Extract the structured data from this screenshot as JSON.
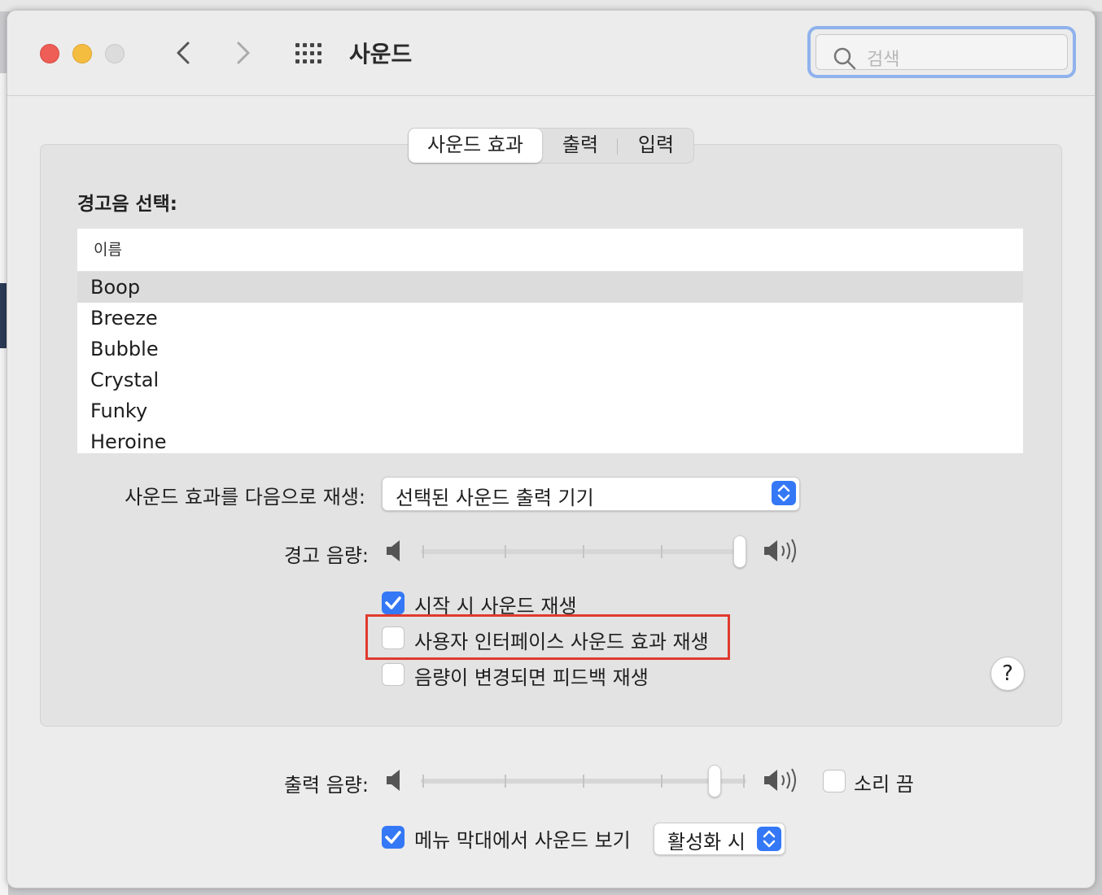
{
  "window": {
    "title": "사운드",
    "search_placeholder": "검색"
  },
  "tabs": [
    {
      "label": "사운드 효과",
      "active": true
    },
    {
      "label": "출력",
      "active": false
    },
    {
      "label": "입력",
      "active": false
    }
  ],
  "alert_section": {
    "label": "경고음 선택:",
    "column_header": "이름",
    "sounds": [
      "Boop",
      "Breeze",
      "Bubble",
      "Crystal",
      "Funky",
      "Heroine"
    ],
    "selected": "Boop"
  },
  "play_through": {
    "label": "사운드 효과를 다음으로 재생:",
    "value": "선택된 사운드 출력 기기"
  },
  "alert_volume": {
    "label": "경고 음량:",
    "level": 1.0
  },
  "checkboxes": [
    {
      "label": "시작 시 사운드 재생",
      "checked": true
    },
    {
      "label": "사용자 인터페이스 사운드 효과 재생",
      "checked": false
    },
    {
      "label": "음량이 변경되면 피드백 재생",
      "checked": false
    }
  ],
  "help_label": "?",
  "output_volume": {
    "label": "출력 음량:",
    "level": 0.92,
    "mute_label": "소리 끔",
    "muted": false
  },
  "menu_bar": {
    "label": "메뉴 막대에서 사운드 보기",
    "checked": true,
    "option": "활성화 시"
  },
  "colors": {
    "accent": "#3478f6",
    "highlight_box": "#e03a30"
  }
}
